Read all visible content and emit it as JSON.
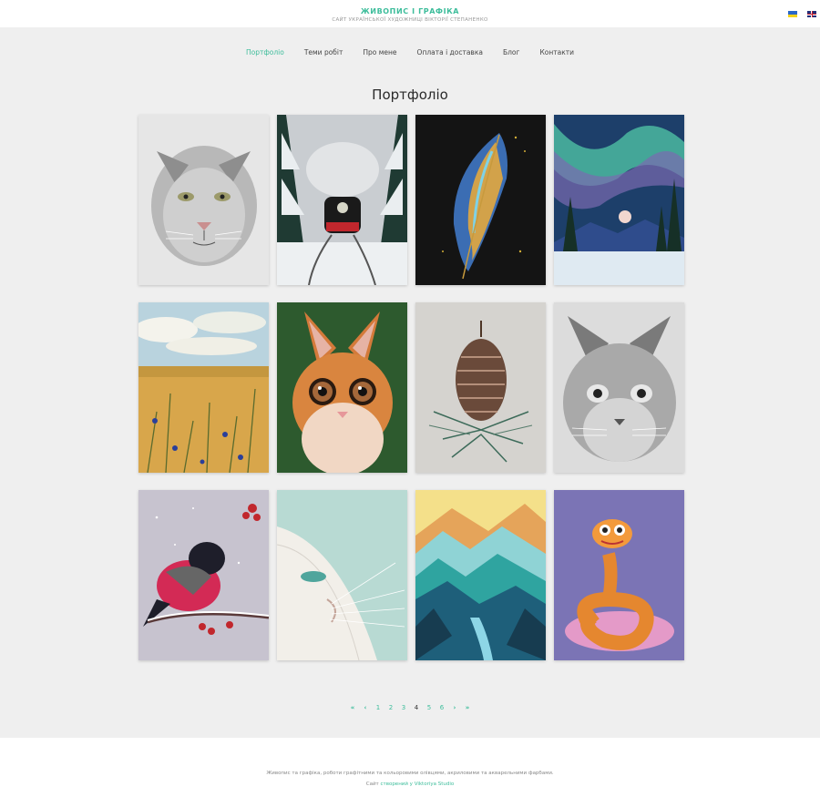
{
  "header": {
    "title": "ЖИВОПИС І ГРАФІКА",
    "subtitle": "САЙТ УКРАЇНСЬКОЇ ХУДОЖНИЦІ ВІКТОРІЇ СТЕПАНЕНКО",
    "languages": [
      "ua-flag-icon",
      "en-flag-icon"
    ]
  },
  "nav": {
    "items": [
      "Портфоліо",
      "Теми робіт",
      "Про мене",
      "Оплата і доставка",
      "Блог",
      "Контакти"
    ],
    "active": "Портфоліо"
  },
  "page": {
    "title": "Портфоліо"
  },
  "gallery": [
    {
      "subject": "cougar-drawing"
    },
    {
      "subject": "winter-train-painting"
    },
    {
      "subject": "feather-painting"
    },
    {
      "subject": "northern-lights-painting"
    },
    {
      "subject": "wheat-field-painting"
    },
    {
      "subject": "ginger-kitten-painting"
    },
    {
      "subject": "pine-cone-painting"
    },
    {
      "subject": "cat-drawing"
    },
    {
      "subject": "bullfinch-painting"
    },
    {
      "subject": "white-cat-painting"
    },
    {
      "subject": "mountain-valley-painting"
    },
    {
      "subject": "snake-painting"
    }
  ],
  "pagination": {
    "first": "«",
    "prev": "‹",
    "pages": [
      "1",
      "2",
      "3",
      "4",
      "5",
      "6"
    ],
    "current": "4",
    "next": "›",
    "last": "»"
  },
  "footer": {
    "line1": "Живопис та графіка, роботи графітними та кольоровими олівцями, акриловими та акварельними фарбами.",
    "line2_prefix": "Сайт",
    "line2_link": "створений у Viktoriya Studio"
  },
  "colors": {
    "accent": "#3dbd9b",
    "background": "#efefef"
  }
}
